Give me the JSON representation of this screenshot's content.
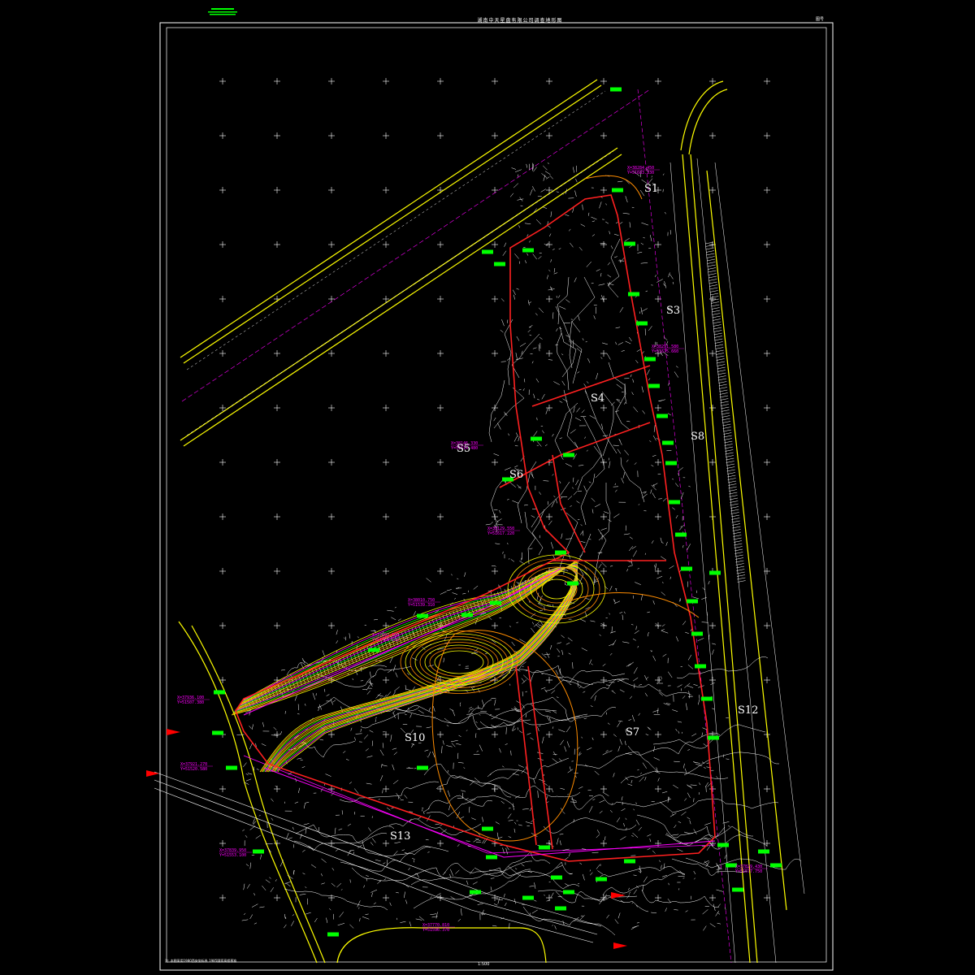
{
  "drawing": {
    "title": "湖南中天星盘有限公司调查地形图",
    "sheet_no": "图号",
    "scale": "1:500",
    "notes": "注: 本图采用1980西安坐标系 1985国家高程基准"
  },
  "parcels": [
    "S1",
    "S3",
    "S4",
    "S5",
    "S6",
    "S7",
    "S8",
    "S10",
    "S12",
    "S13"
  ],
  "colors": {
    "background": "#000000",
    "frame": "#ffffff",
    "road": "#ffff00",
    "boundary": "#ff2020",
    "contour_a": "#ffff00",
    "contour_b": "#ff8c00",
    "labels": "#00ff00",
    "coord_text": "#ff00ff",
    "terrain": "#ffffff",
    "grid_cross": "#ffffff"
  },
  "coordinate_labels": [
    "X=38284.450 Y=51683.330",
    "X=38291.580 Y=51675.660",
    "X=38146.330 Y=51614.480",
    "X=38129.550 Y=51617.220",
    "X=38010.750 Y=51539.310",
    "X=37992.160 Y=51465.280",
    "X=37936.100 Y=51507.380",
    "X=37921.270 Y=51520.580",
    "X=37839.950 Y=51553.100",
    "X=37829.430 Y=51577.750",
    "X=37770.810 Y=51596.370"
  ]
}
